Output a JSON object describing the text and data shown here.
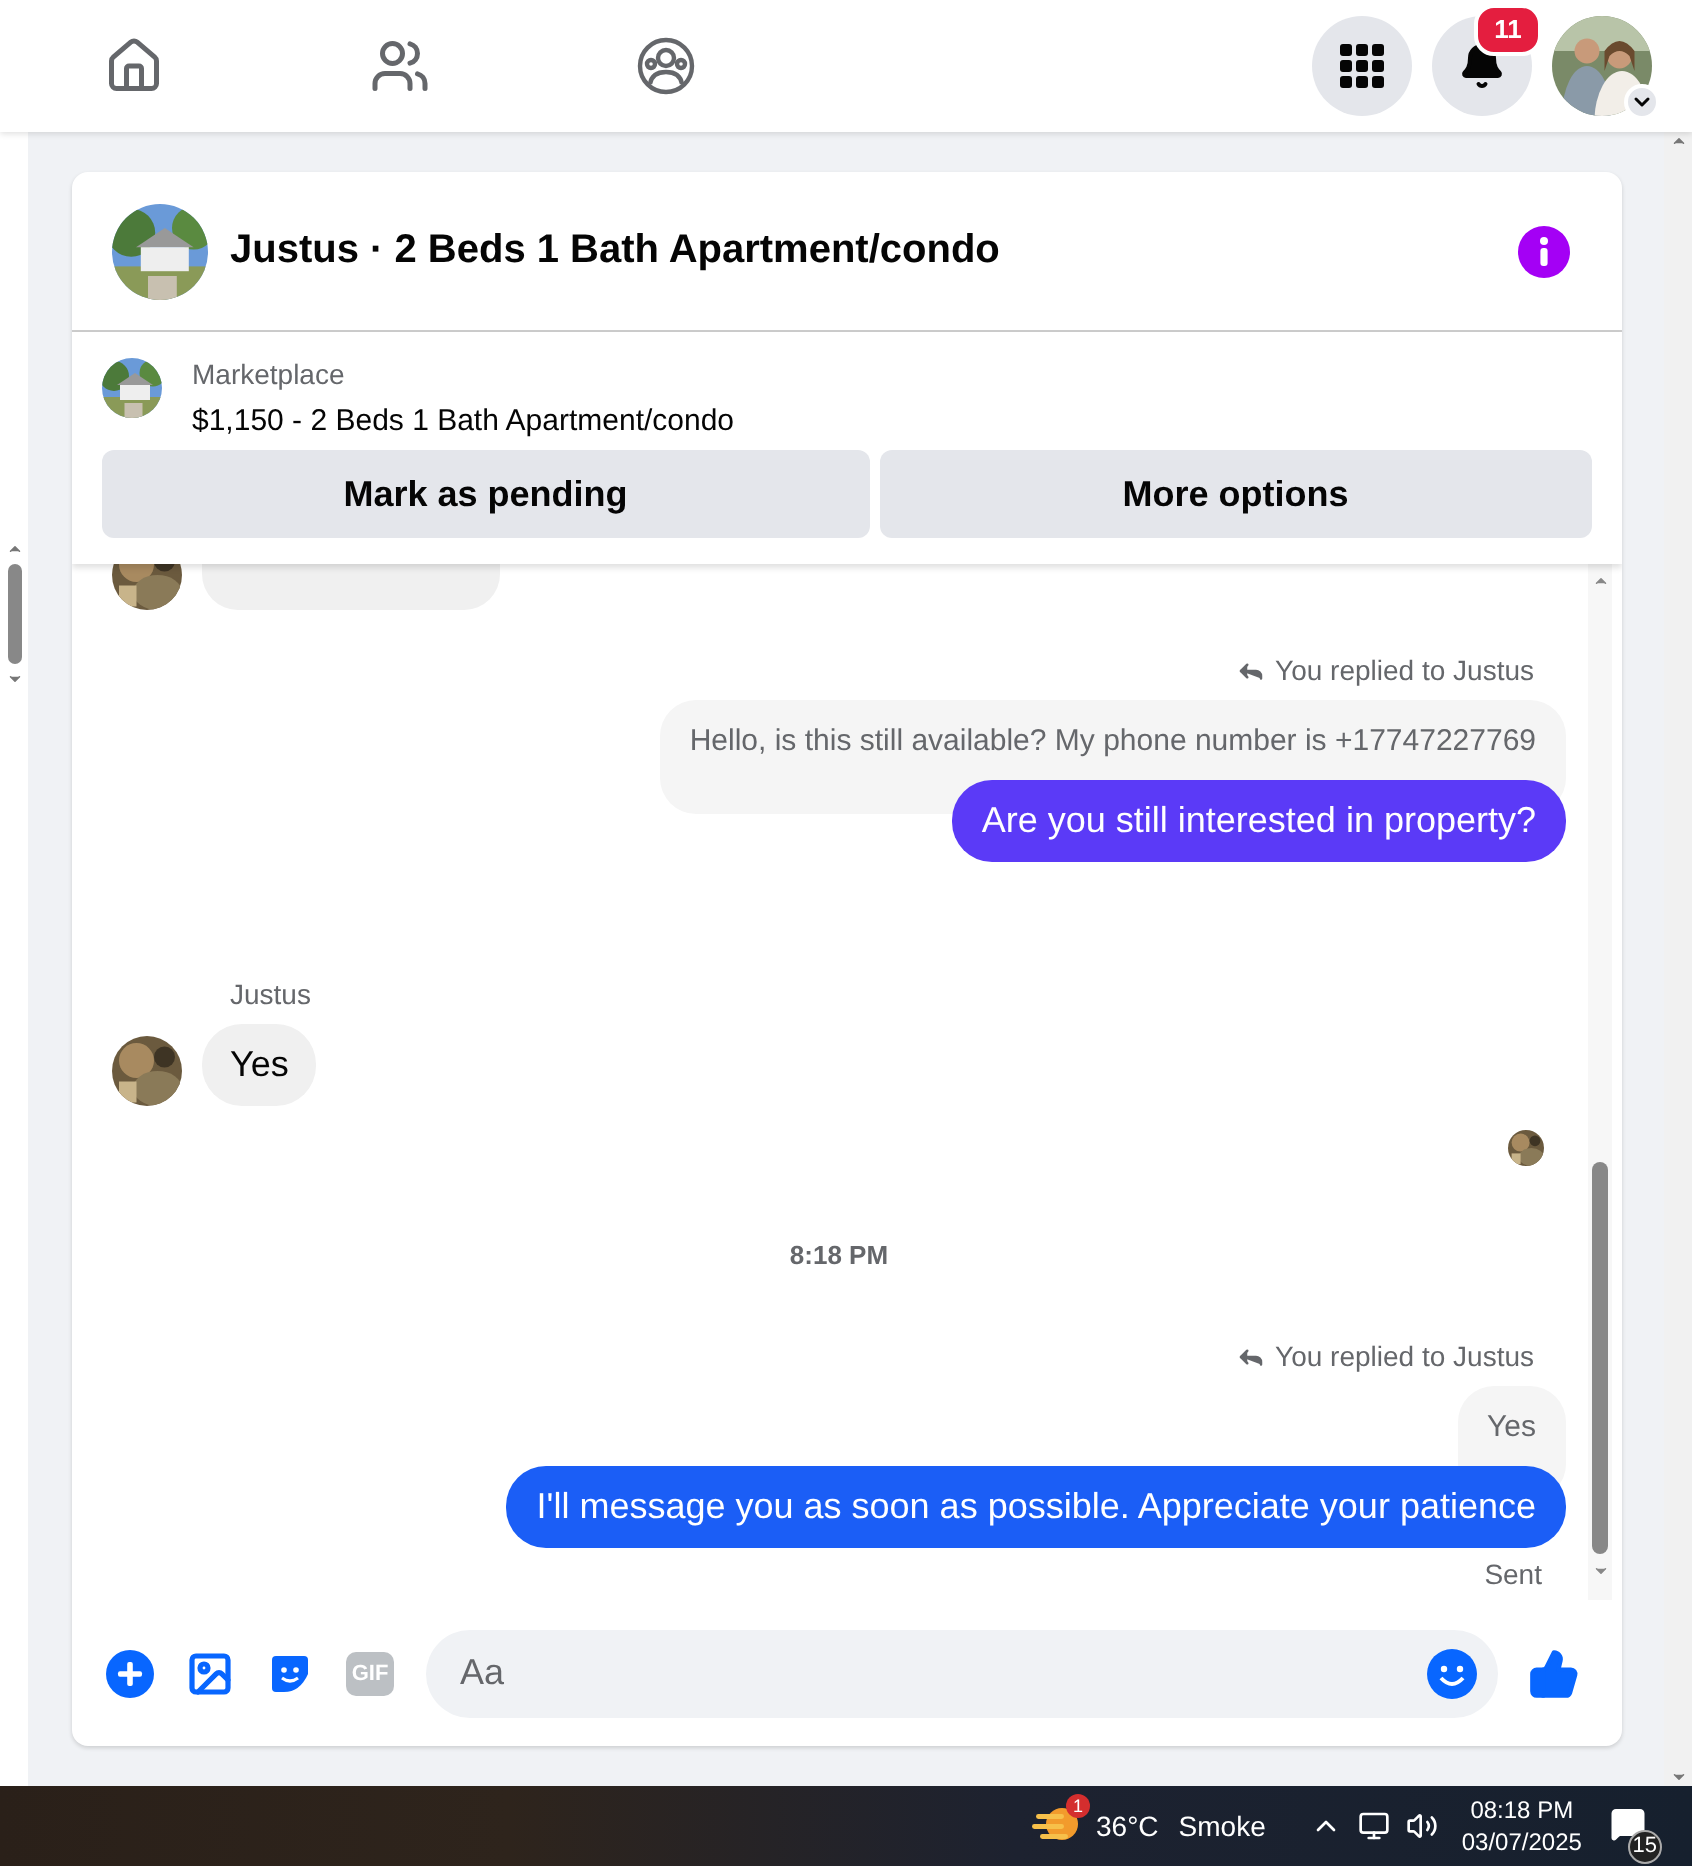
{
  "nav": {
    "notification_count": "11"
  },
  "conversation": {
    "title": "Justus · 2 Beds 1 Bath Apartment/condo"
  },
  "listing": {
    "source": "Marketplace",
    "summary": "$1,150 - 2 Beds 1 Bath Apartment/condo",
    "buttons": [
      "Mark as pending",
      "More options"
    ]
  },
  "messages": [
    {
      "kind": "incoming_cut"
    },
    {
      "kind": "reply",
      "note": "You replied to Justus",
      "quote": "Hello, is this still available? My phone number is +17747227769",
      "text": "Are you still interested in property?",
      "color": "#5b3af7"
    },
    {
      "kind": "incoming",
      "sender": "Justus",
      "text": "Yes"
    },
    {
      "kind": "seen"
    },
    {
      "kind": "time",
      "text": "8:18 PM"
    },
    {
      "kind": "reply",
      "note": "You replied to Justus",
      "quote": "Yes",
      "text": "I'll message you as soon as possible. Appreciate your patience",
      "color": "#1b5ef6",
      "status": "Sent"
    }
  ],
  "composer": {
    "gif_label": "GIF",
    "placeholder": "Aa"
  },
  "taskbar": {
    "weather_badge": "1",
    "temperature": "36°C",
    "condition": "Smoke",
    "time": "08:18 PM",
    "date": "03/07/2025",
    "notifications": "15"
  }
}
